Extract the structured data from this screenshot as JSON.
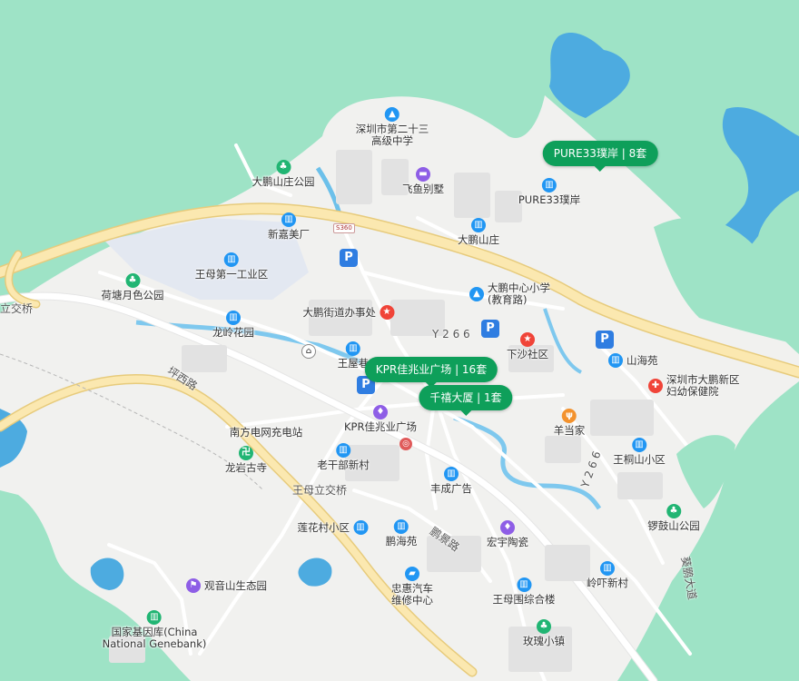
{
  "colors": {
    "land": "#f1f1ef",
    "green": "#9ee3c6",
    "water": "#4dabe0",
    "highway_fill": "#fbe8b0",
    "highway_edge": "#e7cb7c",
    "tag_bg": "#0e9f5a"
  },
  "listings": [
    {
      "label": "PURE33璞岸 | 8套"
    },
    {
      "label": "KPR佳兆业广场 | 16套"
    },
    {
      "label": "千禧大厦 | 1套"
    }
  ],
  "pois": [
    {
      "name": "深圳市第二十三\n高级中学",
      "icon": "school-icon",
      "color": "blue"
    },
    {
      "name": "飞鱼别墅",
      "icon": "hotel-icon",
      "color": "purple"
    },
    {
      "name": "PURE33璞岸",
      "icon": "building-icon",
      "color": "blue"
    },
    {
      "name": "大鹏山庄",
      "icon": "building-icon",
      "color": "blue"
    },
    {
      "name": "大鹏山庄公园",
      "icon": "park-icon",
      "color": "green"
    },
    {
      "name": "新嘉美厂",
      "icon": "factory-icon",
      "color": "blue"
    },
    {
      "name": "王母第一工业区",
      "icon": "factory-icon",
      "color": "blue"
    },
    {
      "name": "荷塘月色公园",
      "icon": "park-icon",
      "color": "green"
    },
    {
      "name": "大鹏街道办事处",
      "icon": "government-icon",
      "color": "red"
    },
    {
      "name": "大鹏中心小学\n(教育路)",
      "icon": "school-icon",
      "color": "blue"
    },
    {
      "name": "龙岭花园",
      "icon": "building-icon",
      "color": "blue"
    },
    {
      "name": "下沙社区",
      "icon": "government-icon",
      "color": "red"
    },
    {
      "name": "山海苑",
      "icon": "building-icon",
      "color": "blue"
    },
    {
      "name": "王屋巷",
      "icon": "building-icon",
      "color": "blue"
    },
    {
      "name": "深圳市大鹏新区\n妇幼保健院",
      "icon": "hospital-icon",
      "color": "red"
    },
    {
      "name": "KPR佳兆业广场",
      "icon": "shopping-icon",
      "color": "purple"
    },
    {
      "name": "羊当家",
      "icon": "restaurant-icon",
      "color": "orange"
    },
    {
      "name": "南方电网充电站",
      "icon": "charging-icon",
      "color": "blue"
    },
    {
      "name": "王桐山小区",
      "icon": "building-icon",
      "color": "blue"
    },
    {
      "name": "老干部新村",
      "icon": "building-icon",
      "color": "blue"
    },
    {
      "name": "龙岩古寺",
      "icon": "temple-icon",
      "color": "green"
    },
    {
      "name": "丰成广告",
      "icon": "building-icon",
      "color": "blue"
    },
    {
      "name": "锣鼓山公园",
      "icon": "park-icon",
      "color": "green"
    },
    {
      "name": "莲花村小区",
      "icon": "building-icon",
      "color": "blue"
    },
    {
      "name": "鹏海苑",
      "icon": "building-icon",
      "color": "blue"
    },
    {
      "name": "宏宇陶瓷",
      "icon": "shopping-icon",
      "color": "purple"
    },
    {
      "name": "观音山生态园",
      "icon": "attraction-icon",
      "color": "purple"
    },
    {
      "name": "忠惠汽车\n维修中心",
      "icon": "car-icon",
      "color": "blue"
    },
    {
      "name": "岭吓新村",
      "icon": "building-icon",
      "color": "blue"
    },
    {
      "name": "王母围综合楼",
      "icon": "building-icon",
      "color": "blue"
    },
    {
      "name": "国家基因库(China\nNational Genebank)",
      "icon": "building-icon",
      "color": "green"
    },
    {
      "name": "玫瑰小镇",
      "icon": "park-icon",
      "color": "green"
    }
  ],
  "roads": {
    "xiyuan": "坪西路",
    "wangmu_bridge": "王母立交桥",
    "left_bridge": "立交桥",
    "y266_a": "Y 2 6 6",
    "y266_b": "Y 2 6 6",
    "pengjing": "鹏景路",
    "kuipeng": "葵鹏大道",
    "s360": "S360"
  }
}
